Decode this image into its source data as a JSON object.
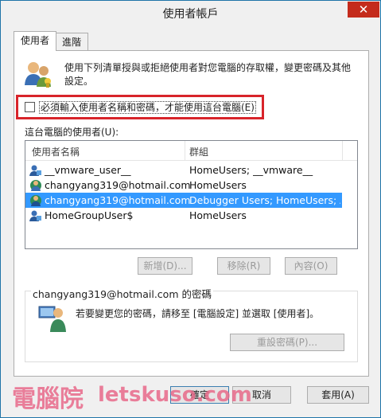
{
  "window": {
    "title": "使用者帳戶",
    "close_glyph": "✕"
  },
  "tabs": [
    {
      "label": "使用者"
    },
    {
      "label": "進階"
    }
  ],
  "description": "使用下列清單授與或拒絕使用者對您電腦的存取權，變更密碼及其他設定。",
  "checkbox": {
    "label": "必須輸入使用者名稱和密碼，才能使用這台電腦(E)",
    "checked": false
  },
  "users_section": {
    "label": "這台電腦的使用者(U):",
    "columns": {
      "name": "使用者名稱",
      "group": "群組"
    },
    "rows": [
      {
        "name": "__vmware_user__",
        "group": "HomeUsers; __vmware__",
        "selected": false
      },
      {
        "name": "changyang319@hotmail.com",
        "group": "HomeUsers",
        "selected": false
      },
      {
        "name": "changyang319@hotmail.com",
        "group": "Debugger Users; HomeUsers; A...",
        "selected": true
      },
      {
        "name": "HomeGroupUser$",
        "group": "HomeUsers",
        "selected": false
      }
    ]
  },
  "list_buttons": {
    "add": "新增(D)...",
    "remove": "移除(R)",
    "properties": "內容(O)"
  },
  "password_group": {
    "title": "changyang319@hotmail.com 的密碼",
    "description": "若要變更您的密碼，請移至 [電腦設定] 並選取 [使用者]。",
    "reset_button": "重設密碼(P)..."
  },
  "footer": {
    "ok": "確定",
    "cancel": "取消",
    "apply": "套用(A)"
  },
  "watermark": {
    "text_cjk": "電腦院",
    "text_latin": "letskuso.com"
  },
  "colors": {
    "highlight": "#d8242a",
    "selection": "#3399ff",
    "close": "#c42b1c"
  }
}
